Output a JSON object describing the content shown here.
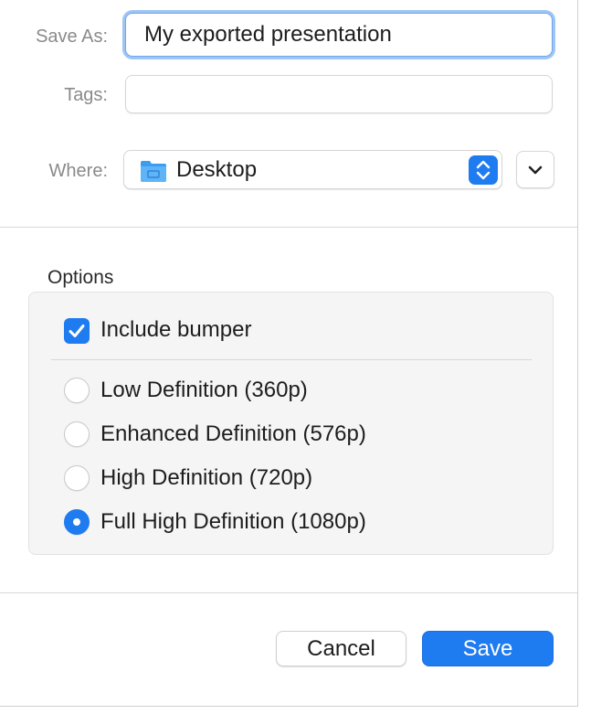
{
  "form": {
    "save_as_label": "Save As:",
    "save_as_value": "My exported presentation",
    "tags_label": "Tags:",
    "tags_value": "",
    "where_label": "Where:",
    "where_value": "Desktop",
    "where_icon": "folder-icon",
    "expand_icon": "chevron-down-icon"
  },
  "options": {
    "title": "Options",
    "include_bumper_label": "Include bumper",
    "include_bumper_checked": true,
    "resolutions": [
      {
        "label": "Low Definition (360p)",
        "selected": false
      },
      {
        "label": "Enhanced Definition (576p)",
        "selected": false
      },
      {
        "label": "High Definition (720p)",
        "selected": false
      },
      {
        "label": "Full High Definition (1080p)",
        "selected": true
      }
    ]
  },
  "buttons": {
    "cancel_label": "Cancel",
    "save_label": "Save"
  },
  "colors": {
    "accent": "#1f7bf0",
    "label_gray": "#8a8a8a",
    "options_bg": "#f5f5f5"
  }
}
